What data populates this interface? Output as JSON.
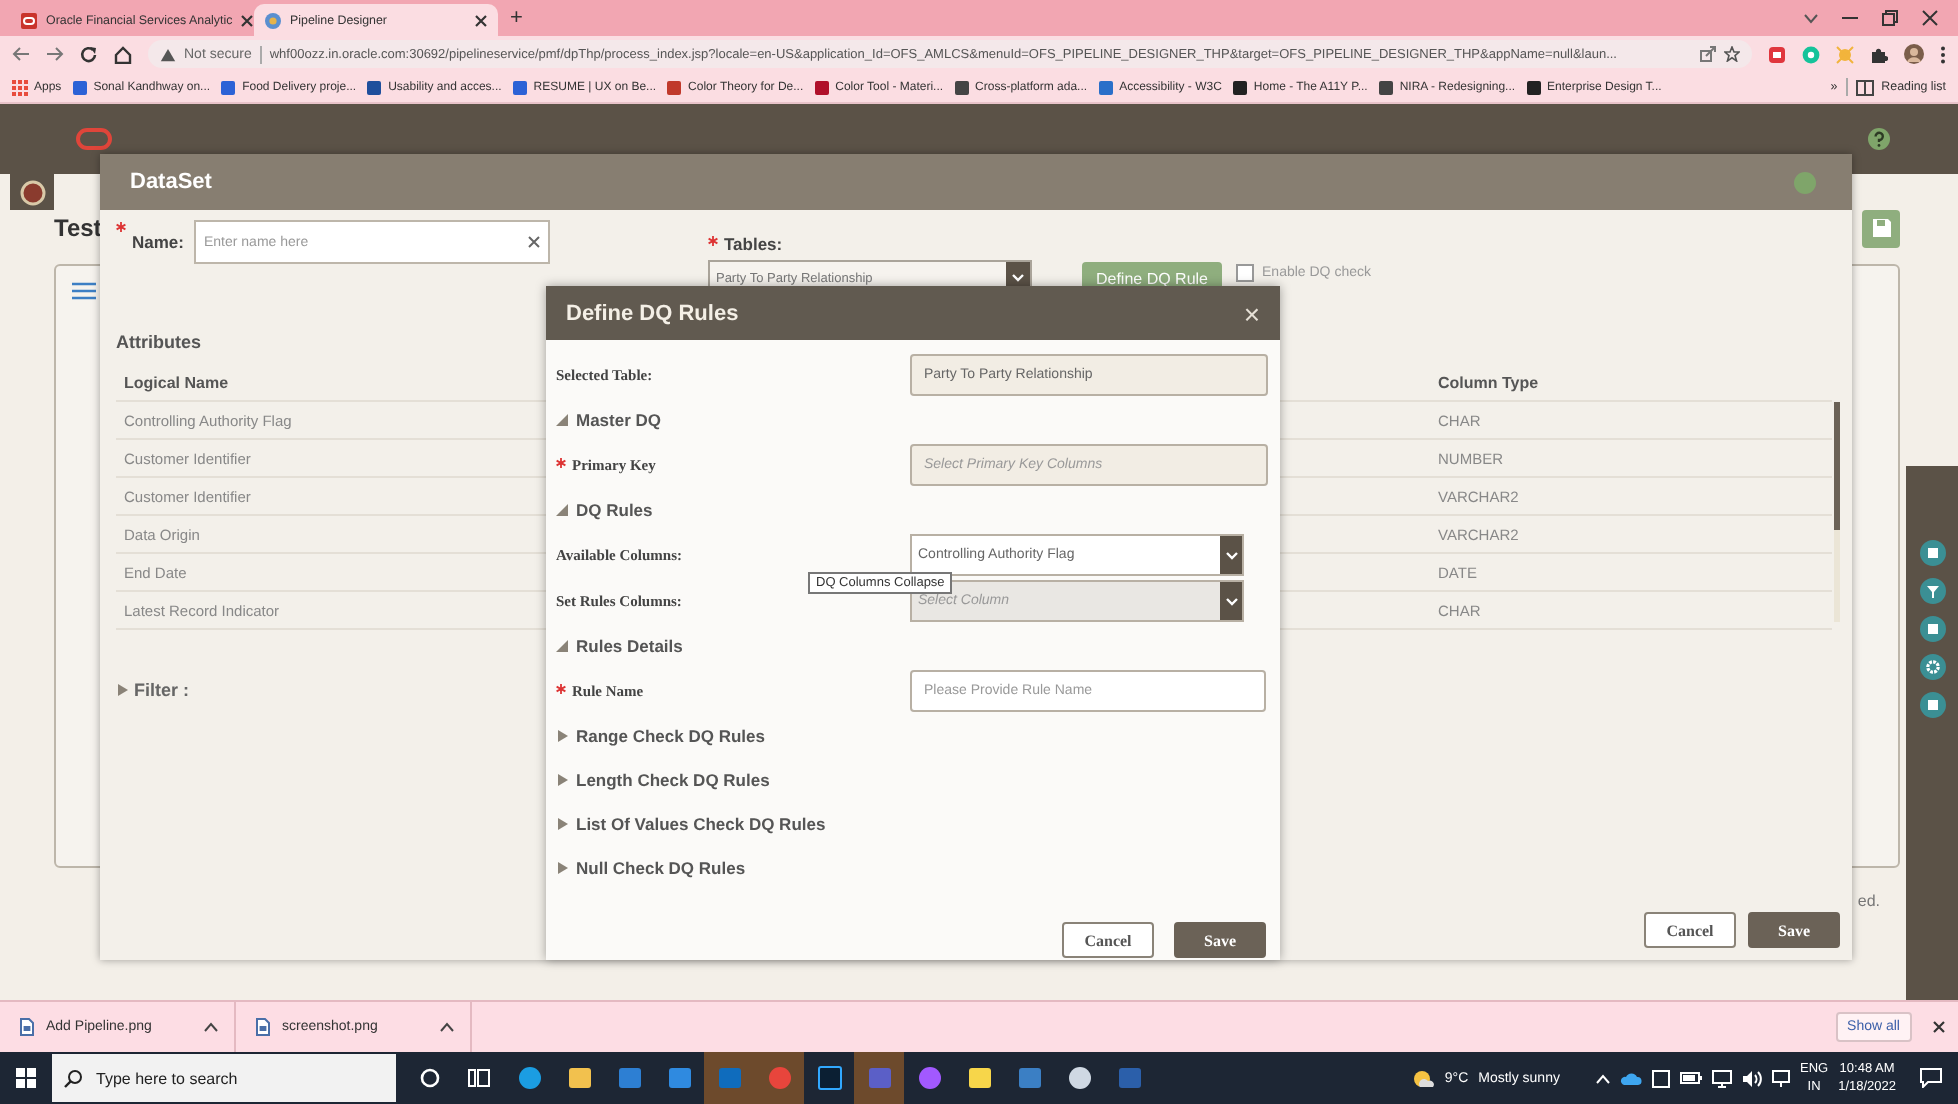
{
  "browser": {
    "tabs": [
      {
        "title": "Oracle Financial Services Analytic",
        "selected": false
      },
      {
        "title": "Pipeline Designer",
        "selected": true
      }
    ],
    "new_tab": "+",
    "security": "Not secure",
    "url": "whf00ozz.in.oracle.com:30692/pipelineservice/pmf/dpThp/process_index.jsp?locale=en-US&application_Id=OFS_AMLCS&menuId=OFS_PIPELINE_DESIGNER_THP&target=OFS_PIPELINE_DESIGNER_THP&appName=null&laun...",
    "bookmarks": [
      "Apps",
      "Sonal Kandhway on...",
      "Food Delivery proje...",
      "Usability and acces...",
      "RESUME | UX on Be...",
      "Color Theory for De...",
      "Color Tool - Materi...",
      "Cross-platform ada...",
      "Accessibility - W3C",
      "Home - The A11Y P...",
      "NIRA - Redesigning...",
      "Enterprise Design T..."
    ],
    "more_bookmarks": "»",
    "reading_list": "Reading list"
  },
  "page": {
    "title": "Test",
    "footer_text": "ed."
  },
  "dataset": {
    "title": "DataSet",
    "name_label": "Name:",
    "name_placeholder": "Enter name here",
    "tables_label": "Tables:",
    "tables_value": "Party To Party Relationship",
    "define_button": "Define DQ Rule",
    "enable_dq": {
      "label": "Enable DQ check",
      "checked": false
    },
    "attributes_title": "Attributes",
    "columns": [
      "Logical Name",
      "Column Type"
    ],
    "rows": [
      {
        "logical_name": "Controlling Authority Flag",
        "column_type": "CHAR"
      },
      {
        "logical_name": "Customer Identifier",
        "column_type": "NUMBER"
      },
      {
        "logical_name": "Customer Identifier",
        "column_type": "VARCHAR2"
      },
      {
        "logical_name": "Data Origin",
        "column_type": "VARCHAR2"
      },
      {
        "logical_name": "End Date",
        "column_type": "DATE"
      },
      {
        "logical_name": "Latest Record Indicator",
        "column_type": "CHAR"
      }
    ],
    "filter": {
      "label": "Filter :",
      "expanded": false
    },
    "buttons": [
      {
        "label": "Cancel",
        "kind": "secondary"
      },
      {
        "label": "Save",
        "kind": "primary"
      }
    ]
  },
  "dq_modal": {
    "title": "Define DQ Rules",
    "close": "×",
    "items": [
      {
        "kind": "readonly",
        "label": "Selected Table:",
        "required": false,
        "value": "Party To Party Relationship"
      },
      {
        "kind": "section",
        "title": "Master DQ",
        "expanded": true
      },
      {
        "kind": "readonly",
        "label": "Primary Key",
        "required": true,
        "placeholder": "Select Primary Key Columns"
      },
      {
        "kind": "section",
        "title": "DQ Rules",
        "expanded": true
      },
      {
        "kind": "select",
        "label": "Available Columns:",
        "required": false,
        "value": "Controlling Authority Flag",
        "disabled": false
      },
      {
        "kind": "select",
        "label": "Set Rules Columns:",
        "required": false,
        "placeholder": "Select Column",
        "disabled": true
      },
      {
        "kind": "section",
        "title": "Rules Details",
        "expanded": true
      },
      {
        "kind": "input",
        "label": "Rule Name",
        "required": true,
        "placeholder": "Please Provide Rule Name"
      },
      {
        "kind": "section",
        "title": "Range Check DQ Rules",
        "expanded": false
      },
      {
        "kind": "section",
        "title": "Length Check DQ Rules",
        "expanded": false
      },
      {
        "kind": "section",
        "title": "List Of Values Check DQ Rules",
        "expanded": false
      },
      {
        "kind": "section",
        "title": "Null Check DQ Rules",
        "expanded": false
      }
    ],
    "tooltip": "DQ Columns Collapse",
    "buttons": [
      {
        "label": "Cancel",
        "kind": "secondary"
      },
      {
        "label": "Save",
        "kind": "primary"
      }
    ]
  },
  "downloads": {
    "files": [
      "Add Pipeline.png",
      "screenshot.png"
    ],
    "show_all": "Show all"
  },
  "taskbar": {
    "search_placeholder": "Type here to search",
    "apps": [
      {
        "kind": "edge",
        "active": false
      },
      {
        "kind": "explorer",
        "active": false
      },
      {
        "kind": "store",
        "active": false
      },
      {
        "kind": "mail",
        "active": false
      },
      {
        "kind": "outlook",
        "active": true
      },
      {
        "kind": "chrome",
        "active": true
      },
      {
        "kind": "photoshop",
        "active": false
      },
      {
        "kind": "teams",
        "active": true
      },
      {
        "kind": "figma",
        "active": false
      },
      {
        "kind": "sticky",
        "active": false
      },
      {
        "kind": "photos",
        "active": false
      },
      {
        "kind": "paint",
        "active": false
      },
      {
        "kind": "word",
        "active": false
      }
    ],
    "temperature": "9°C",
    "weather": "Mostly sunny",
    "language": "ENG",
    "region": "IN",
    "time": "10:48 AM",
    "date": "1/18/2022"
  }
}
